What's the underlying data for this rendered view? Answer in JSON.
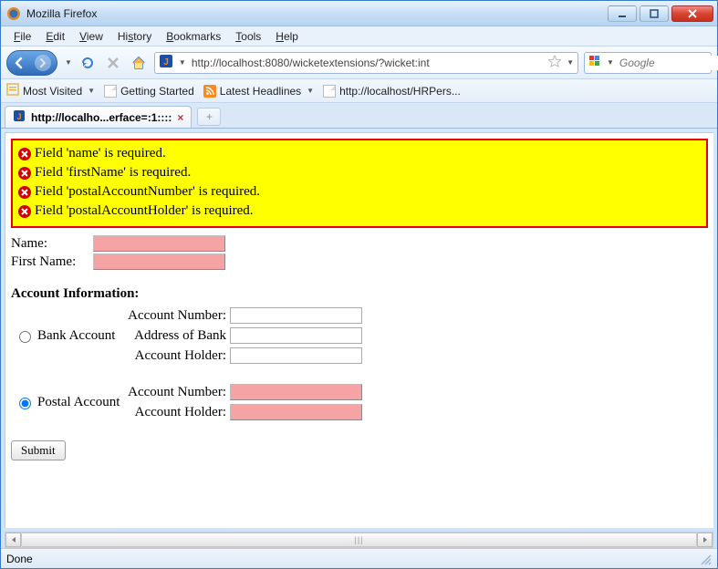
{
  "window": {
    "title": "Mozilla Firefox"
  },
  "menu": {
    "file": "File",
    "edit": "Edit",
    "view": "View",
    "history": "History",
    "bookmarks": "Bookmarks",
    "tools": "Tools",
    "help": "Help"
  },
  "toolbar": {
    "url": "http://localhost:8080/wicketextensions/?wicket:int",
    "search_placeholder": "Google"
  },
  "bookmarks": {
    "most_visited": "Most Visited",
    "getting_started": "Getting Started",
    "latest_headlines": "Latest Headlines",
    "hrpersdb": "http://localhost/HRPers..."
  },
  "tab": {
    "title": "http://localho...erface=:1::::"
  },
  "errors": [
    "Field 'name' is required.",
    "Field 'firstName' is required.",
    "Field 'postalAccountNumber' is required.",
    "Field 'postalAccountHolder' is required."
  ],
  "form": {
    "name_label": "Name:",
    "firstname_label": "First Name:",
    "section_header": "Account Information:",
    "bank": {
      "radio_label": "Bank Account",
      "account_number_label": "Account Number:",
      "address_label": "Address of Bank",
      "holder_label": "Account Holder:"
    },
    "postal": {
      "radio_label": "Postal Account",
      "account_number_label": "Account Number:",
      "holder_label": "Account Holder:"
    },
    "submit_label": "Submit"
  },
  "status": {
    "text": "Done"
  }
}
